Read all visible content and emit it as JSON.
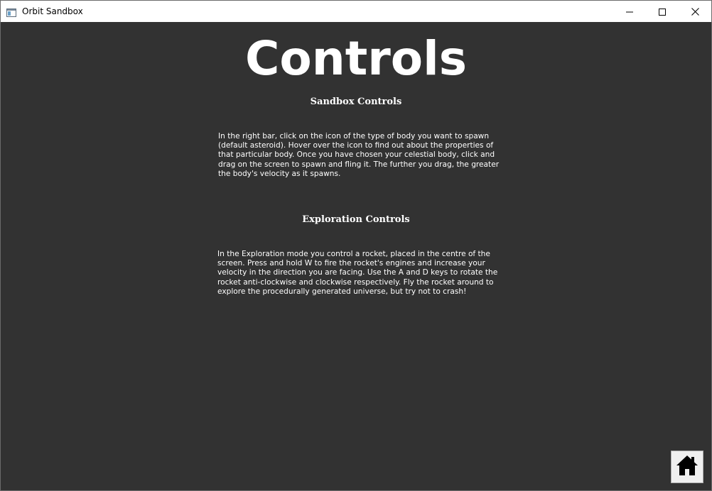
{
  "window": {
    "title": "Orbit Sandbox",
    "app_icon": "window-app-icon",
    "buttons": {
      "minimize_icon": "minimize-icon",
      "maximize_icon": "maximize-icon",
      "close_icon": "close-icon"
    }
  },
  "page": {
    "title": "Controls",
    "sections": [
      {
        "heading": "Sandbox Controls",
        "body": "In the right bar, click on the icon of the type of body you want to spawn (default asteroid). Hover over the icon to find out about the properties of that particular body. Once you have chosen your celestial body, click and drag on the screen to spawn and fling it. The further you drag, the greater the body's velocity as it spawns."
      },
      {
        "heading": "Exploration Controls",
        "body": "In the Exploration mode you control a rocket, placed in the centre of the screen. Press and hold W to fire the rocket's engines and increase your velocity in the direction you are facing. Use the A and D keys to rotate the rocket anti-clockwise and clockwise respectively. Fly the rocket around to explore the procedurally generated universe, but try not to crash!"
      }
    ],
    "home_button": {
      "icon": "home-icon"
    }
  },
  "colors": {
    "background": "#323232",
    "text": "#ffffff",
    "titlebar": "#ffffff",
    "home_button_bg": "#f0f0f0"
  }
}
